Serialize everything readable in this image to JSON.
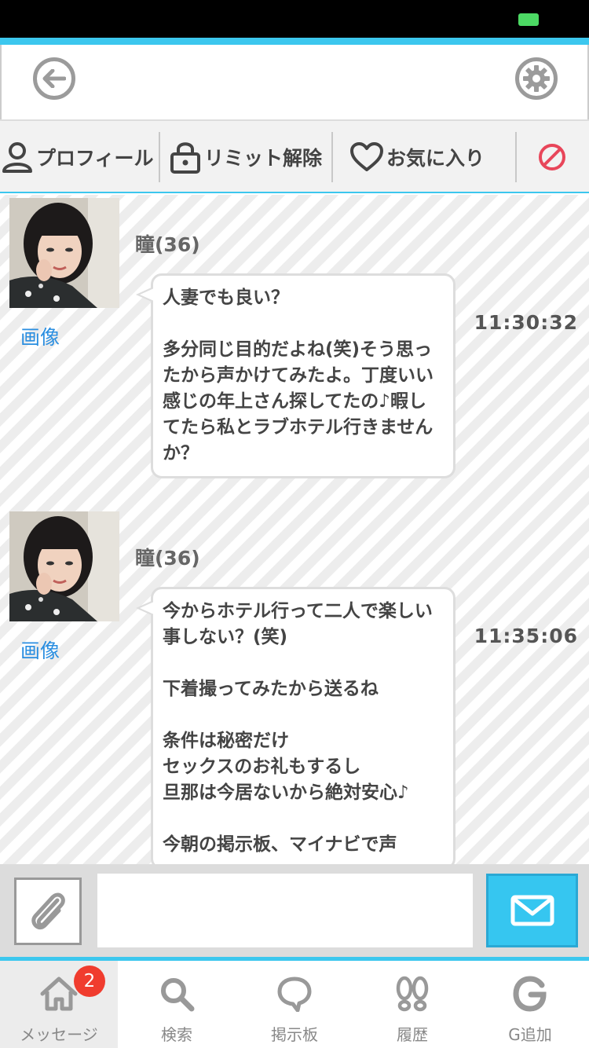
{
  "toolbar": {
    "profile_label": "プロフィール",
    "unlock_label": "リミット解除",
    "favorite_label": "お気に入り"
  },
  "messages": [
    {
      "name": "瞳(36)",
      "image_link": "画像",
      "text": "人妻でも良い？\n\n多分同じ目的だよね(笑)そう思ったから声かけてみたよ。丁度いい感じの年上さん探してたの♪暇してたら私とラブホテル行きませんか？",
      "time": "11:30:32"
    },
    {
      "name": "瞳(36)",
      "image_link": "画像",
      "text": "今からホテル行って二人で楽しい事しない？(笑)\n\n下着撮ってみたから送るね\n\n条件は秘密だけ\nセックスのお礼もするし\n旦那は今居ないから絶対安心♪\n\n今朝の掲示板、マイナビで声",
      "time": "11:35:06"
    }
  ],
  "composer": {
    "value": ""
  },
  "tabs": [
    {
      "label": "メッセージ",
      "badge": "2"
    },
    {
      "label": "検索"
    },
    {
      "label": "掲示板"
    },
    {
      "label": "履歴"
    },
    {
      "label": "G追加"
    }
  ],
  "colors": {
    "accent": "#3cc7ee",
    "send_button": "#36c6f0",
    "link": "#2a8ee0",
    "badge": "#f03c2e",
    "block_icon": "#e8465a"
  }
}
